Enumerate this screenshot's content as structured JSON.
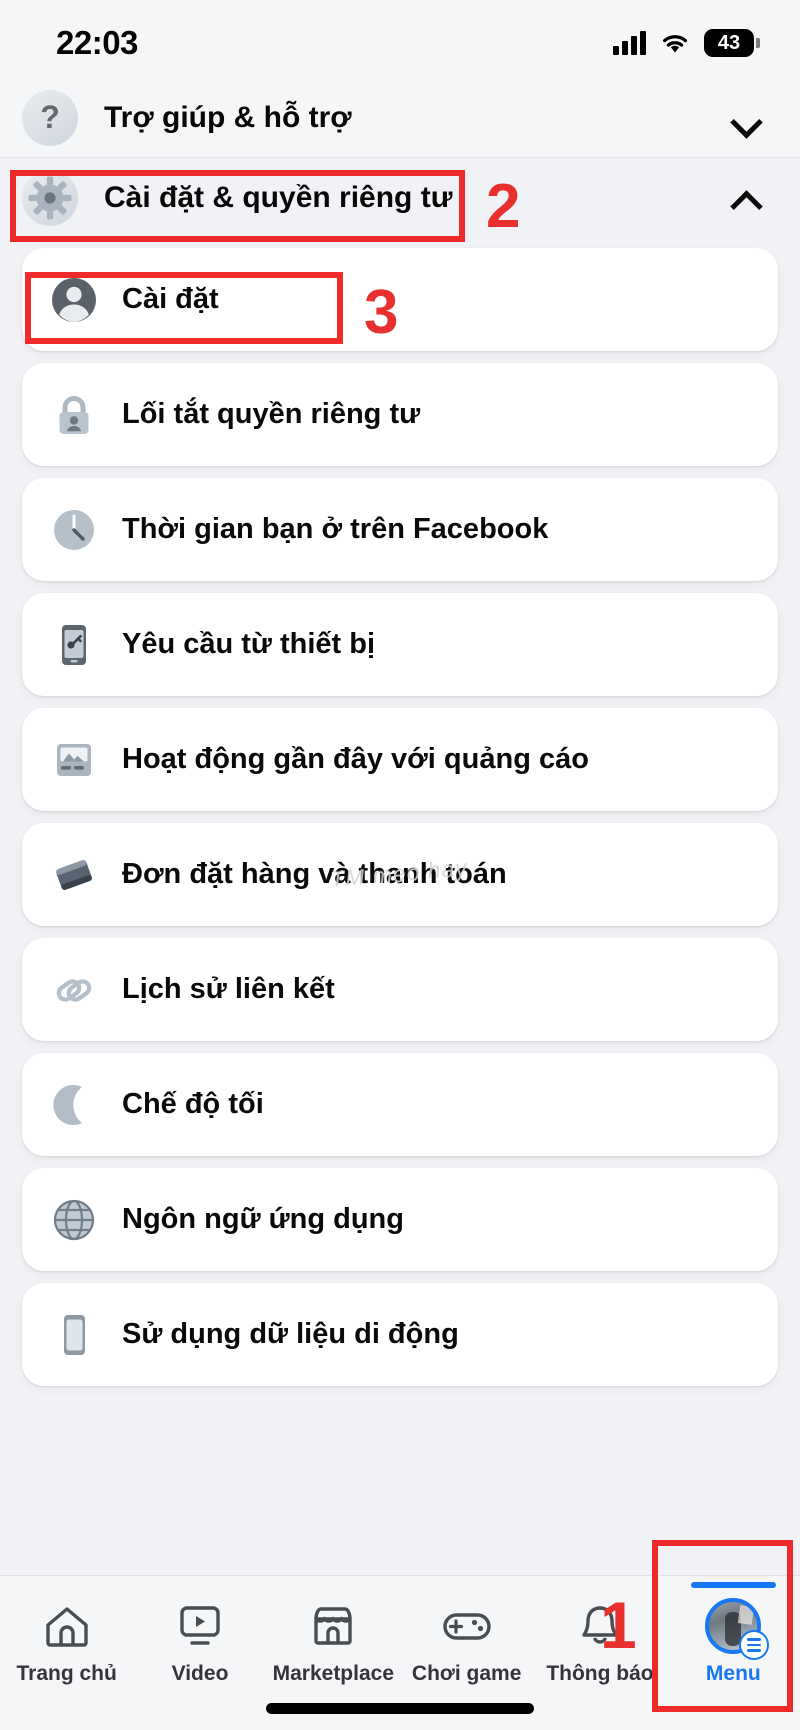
{
  "status_bar": {
    "time": "22:03",
    "battery_level": "43",
    "signal_icon": "cellular-bars-icon",
    "wifi_icon": "wifi-icon",
    "battery_icon": "battery-icon"
  },
  "sections": [
    {
      "label": "Trợ giúp & hỗ trợ",
      "icon": "question-mark-icon",
      "chevron": "chevron-down-icon",
      "expanded": false
    },
    {
      "label": "Cài đặt & quyền riêng tư",
      "icon": "gear-icon",
      "chevron": "chevron-up-icon",
      "expanded": true
    }
  ],
  "menu_items": [
    {
      "label": "Cài đặt",
      "icon": "person-circle-icon"
    },
    {
      "label": "Lối tắt quyền riêng tư",
      "icon": "lock-person-icon"
    },
    {
      "label": "Thời gian bạn ở trên Facebook",
      "icon": "clock-icon"
    },
    {
      "label": "Yêu cầu từ thiết bị",
      "icon": "phone-key-icon"
    },
    {
      "label": "Hoạt động gần đây với quảng cáo",
      "icon": "ad-activity-icon"
    },
    {
      "label": "Đơn đặt hàng và thanh toán",
      "icon": "wallet-icon"
    },
    {
      "label": "Lịch sử liên kết",
      "icon": "link-chain-icon"
    },
    {
      "label": "Chế độ tối",
      "icon": "moon-icon"
    },
    {
      "label": "Ngôn ngữ ứng dụng",
      "icon": "globe-icon"
    },
    {
      "label": "Sử dụng dữ liệu di động",
      "icon": "mobile-phone-icon"
    }
  ],
  "bottom_nav": [
    {
      "label": "Trang chủ",
      "icon": "home-icon",
      "active": false
    },
    {
      "label": "Video",
      "icon": "video-icon",
      "active": false
    },
    {
      "label": "Marketplace",
      "icon": "storefront-icon",
      "active": false
    },
    {
      "label": "Chơi game",
      "icon": "gamepad-icon",
      "active": false
    },
    {
      "label": "Thông báo",
      "icon": "bell-icon",
      "active": false
    },
    {
      "label": "Menu",
      "icon": "profile-avatar-menu-icon",
      "active": true
    }
  ],
  "annotations": {
    "color": "#ee2a2a",
    "steps": [
      {
        "number": "1",
        "target": "Menu"
      },
      {
        "number": "2",
        "target": "Cài đặt & quyền riêng tư"
      },
      {
        "number": "3",
        "target": "Cài đặt"
      }
    ]
  },
  "watermark": {
    "text": "TM  mẹo hay"
  }
}
